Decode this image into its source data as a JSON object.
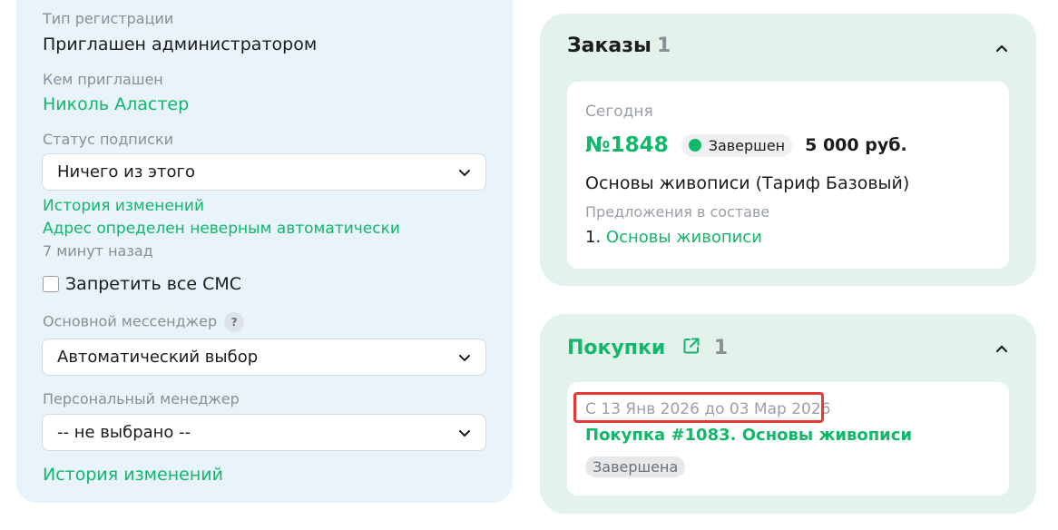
{
  "left": {
    "registration_type_label": "Тип регистрации",
    "registration_type_value": "Приглашен администратором",
    "invited_by_label": "Кем приглашен",
    "invited_by_value": "Николь Аластер",
    "subscription_status_label": "Статус подписки",
    "subscription_status_value": "Ничего из этого",
    "history_link": "История изменений",
    "address_link": "Адрес определен неверным автоматически",
    "time_ago": "7 минут назад",
    "sms_checkbox_label": "Запретить все СМС",
    "messenger_label": "Основной мессенджер",
    "messenger_help": "?",
    "messenger_value": "Автоматический выбор",
    "manager_label": "Персональный менеджер",
    "manager_value": "-- не выбрано --",
    "history_link_bottom": "История изменений"
  },
  "orders": {
    "title": "Заказы",
    "count": "1",
    "day": "Сегодня",
    "number": "№1848",
    "status": "Завершен",
    "price": "5 000 руб.",
    "product": "Основы живописи (Тариф Базовый)",
    "offers_label": "Предложения в составе",
    "offer_index": "1.",
    "offer_item": "Основы живописи"
  },
  "purchases": {
    "title": "Покупки",
    "count": "1",
    "period": "С 13 Янв 2026 до 03 Мар 2026",
    "link": "Покупка #1083. Основы живописи",
    "status": "Завершена"
  },
  "colors": {
    "accent_green": "#12b76a",
    "left_panel_bg": "#e8f3fb",
    "card_bg": "#e3f3ec",
    "highlight_red": "#e53935"
  }
}
